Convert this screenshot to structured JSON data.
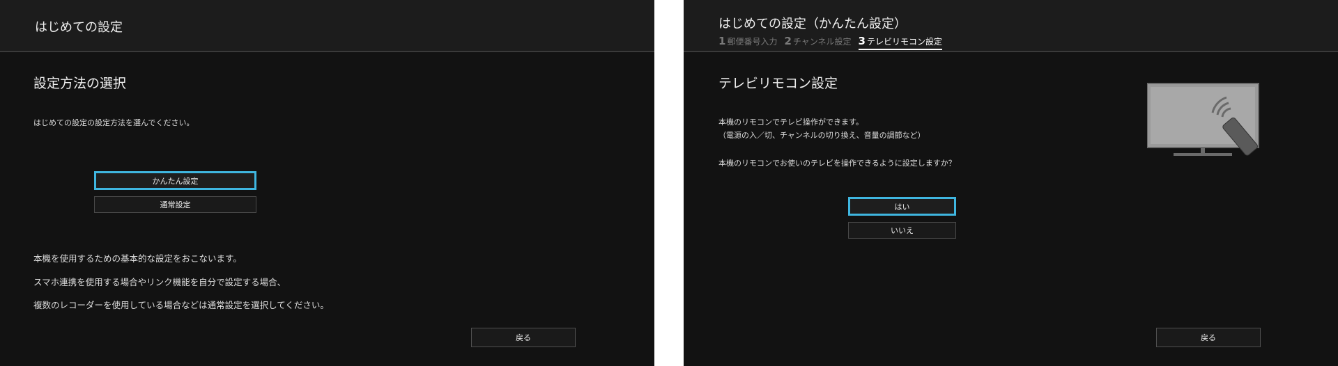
{
  "left_screen": {
    "header_title": "はじめての設定",
    "heading": "設定方法の選択",
    "instruction": "はじめての設定の設定方法を選んでください。",
    "options": [
      "かんたん設定",
      "通常設定"
    ],
    "notes": [
      "本機を使用するための基本的な設定をおこないます。",
      "スマホ連携を使用する場合やリンク機能を自分で設定する場合、",
      "複数のレコーダーを使用している場合などは通常設定を選択してください。"
    ],
    "back_label": "戻る"
  },
  "right_screen": {
    "header_title": "はじめての設定（かんたん設定）",
    "steps": [
      {
        "num": "1",
        "label": "郵便番号入力"
      },
      {
        "num": "2",
        "label": "チャンネル設定"
      },
      {
        "num": "3",
        "label": "テレビリモコン設定"
      }
    ],
    "active_step": 3,
    "heading": "テレビリモコン設定",
    "lines": [
      "本機のリモコンでテレビ操作ができます。",
      "（電源の入／切、チャンネルの切り換え、音量の調節など）"
    ],
    "question": "本機のリモコンでお使いのテレビを操作できるように設定しますか？",
    "options": [
      "はい",
      "いいえ"
    ],
    "back_label": "戻る",
    "illustration_icon": "tv-remote-icon"
  },
  "colors": {
    "screen_bg": "#121212",
    "header_bg": "#1c1c1c",
    "focus": "#3fb6e0"
  }
}
